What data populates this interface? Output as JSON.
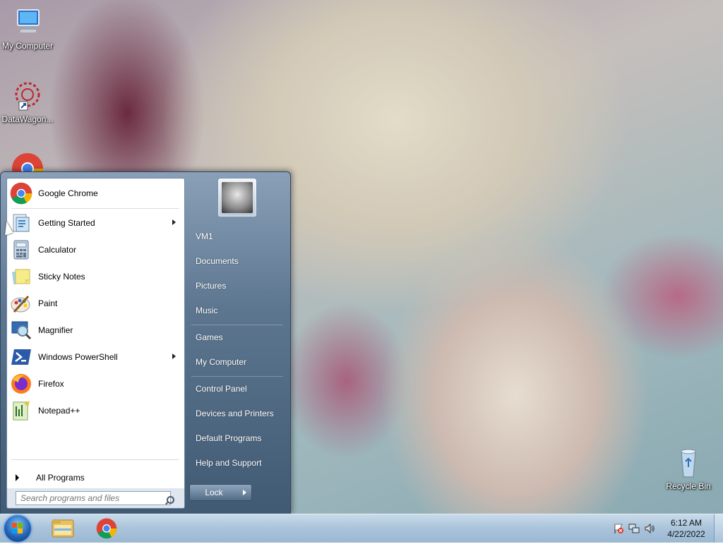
{
  "desktop": {
    "icons": [
      {
        "label": "My Computer",
        "icon": "computer-icon"
      },
      {
        "label": "DataWagon...",
        "icon": "datawagon-icon"
      },
      {
        "label": "Recycle Bin",
        "icon": "recycle-bin-icon"
      }
    ]
  },
  "start_menu": {
    "programs": [
      {
        "label": "Google Chrome",
        "icon": "chrome-icon"
      },
      {
        "label": "Getting Started",
        "icon": "getting-started-icon",
        "submenu": true
      },
      {
        "label": "Calculator",
        "icon": "calculator-icon"
      },
      {
        "label": "Sticky Notes",
        "icon": "sticky-notes-icon"
      },
      {
        "label": "Paint",
        "icon": "paint-icon"
      },
      {
        "label": "Magnifier",
        "icon": "magnifier-icon"
      },
      {
        "label": "Windows PowerShell",
        "icon": "powershell-icon",
        "submenu": true
      },
      {
        "label": "Firefox",
        "icon": "firefox-icon"
      },
      {
        "label": "Notepad++",
        "icon": "notepadpp-icon"
      }
    ],
    "all_programs": "All Programs",
    "search_placeholder": "Search programs and files",
    "right_items": [
      "VM1",
      "Documents",
      "Pictures",
      "Music",
      "Games",
      "My Computer",
      "Control Panel",
      "Devices and Printers",
      "Default Programs",
      "Help and Support"
    ],
    "lock_label": "Lock"
  },
  "taskbar": {
    "time": "6:12 AM",
    "date": "4/22/2022",
    "pinned": [
      "file-explorer-icon",
      "chrome-icon"
    ]
  },
  "colors": {
    "taskbar": "#a9c3da",
    "start_menu": "#5d7690"
  }
}
